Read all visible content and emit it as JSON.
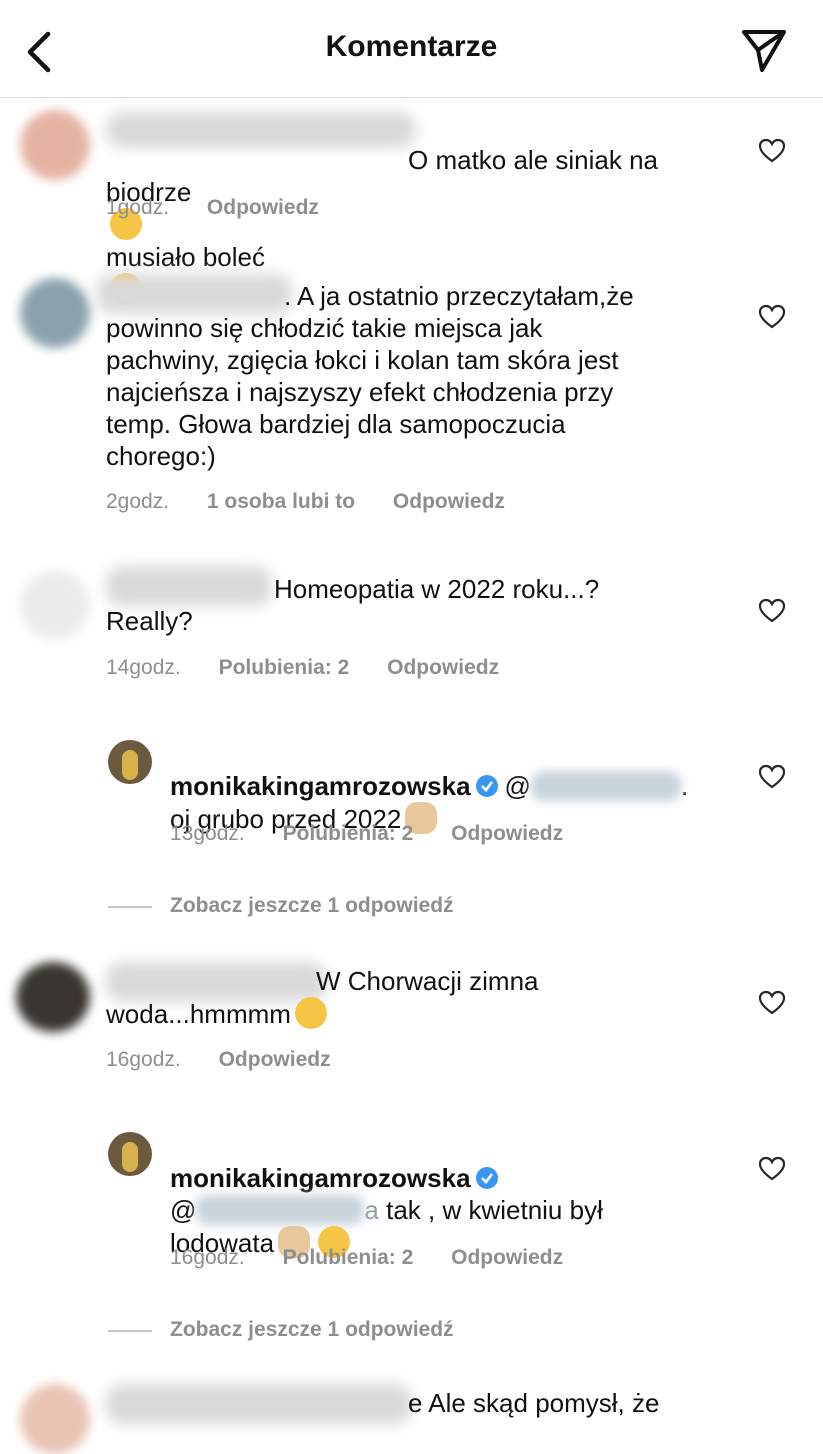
{
  "header": {
    "title": "Komentarze",
    "back_icon": "chevron-left-icon",
    "send_icon": "paper-plane-icon"
  },
  "comments": [
    {
      "text": "O matko ale siniak na\nbiodrze",
      "text_after": "musiało boleć",
      "time": "1godz.",
      "reply": "Odpowiedz"
    },
    {
      "text": ". A ja ostatnio przeczytałam,że\npowinno się chłodzić takie miejsca jak\npachwiny, zgięcia łokci i kolan  tam skóra jest\nnajcieńsza i najszyszy efekt chłodzenia przy\ntemp. Głowa bardziej dla samopoczucia\nchorego:)",
      "time": "2godz.",
      "likes": "1 osoba lubi to",
      "reply": "Odpowiedz"
    },
    {
      "text": "Homeopatia w 2022 roku...?\nReally?",
      "time": "14godz.",
      "likes": "Polubienia: 2",
      "reply": "Odpowiedz"
    },
    {
      "username": "monikakingamrozowska",
      "mention_prefix": "@",
      "text": "oj grubo przed 2022",
      "time": "13godz.",
      "likes": "Polubienia: 2",
      "reply": "Odpowiedz"
    },
    {
      "text": "W Chorwacji zimna\nwoda...hmmmm",
      "time": "16godz.",
      "reply": "Odpowiedz"
    },
    {
      "username": "monikakingamrozowska",
      "mention_prefix": "@",
      "mention_suffix": "a",
      "text": "tak , w kwietniu był",
      "text2": "lodowata",
      "time": "16godz.",
      "likes": "Polubienia: 2",
      "reply": "Odpowiedz"
    },
    {
      "text": "e Ale skąd pomysł, że"
    }
  ],
  "view_more": {
    "label1": "Zobacz jeszcze 1 odpowiedź",
    "label2": "Zobacz jeszcze 1 odpowiedź"
  },
  "colors": {
    "verified": "#3897f0",
    "meta": "#8e8e8e"
  }
}
